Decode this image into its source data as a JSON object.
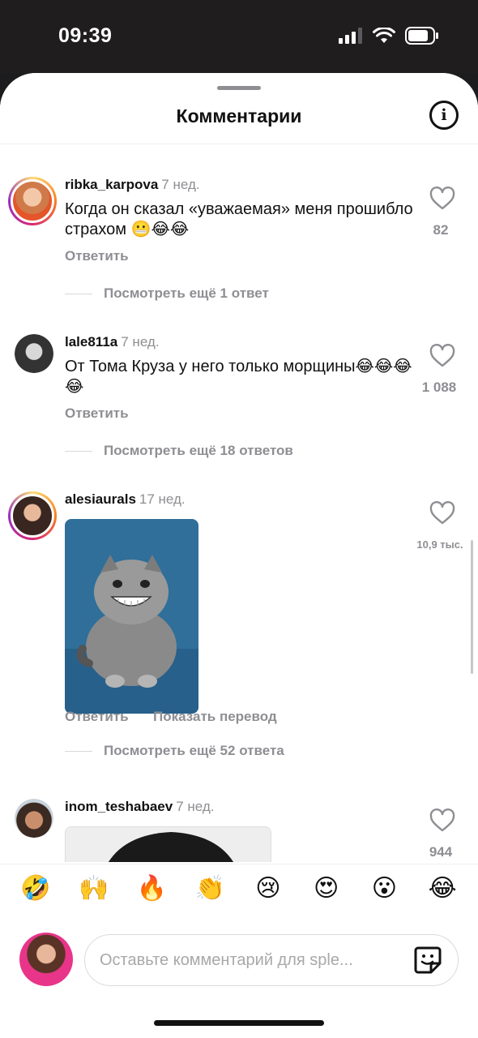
{
  "status": {
    "time": "09:39"
  },
  "header": {
    "title": "Комментарии"
  },
  "comments": [
    {
      "username": "ribka_karpova",
      "time": "7 нед.",
      "text": "Когда он сказал «уважаемая» меня прошибло страхом 😬😂😂",
      "likes": "82",
      "reply": "Ответить",
      "more": "Посмотреть ещё 1 ответ"
    },
    {
      "username": "lale811a",
      "time": "7 нед.",
      "text": "От Тома Круза у него только морщины😂😂😂😂",
      "likes": "1 088",
      "reply": "Ответить",
      "more": "Посмотреть ещё 18 ответов"
    },
    {
      "username": "alesiaurals",
      "time": "17 нед.",
      "likes": "10,9 тыс.",
      "reply": "Ответить",
      "translate": "Показать перевод",
      "more": "Посмотреть ещё 52 ответа"
    },
    {
      "username": "inom_teshabaev",
      "time": "7 нед.",
      "likes": "944"
    }
  ],
  "emoji_bar": [
    "🤣",
    "🙌",
    "🔥",
    "👏",
    "😢",
    "😍",
    "😮",
    "😂"
  ],
  "composer": {
    "placeholder": "Оставьте комментарий для sple..."
  }
}
